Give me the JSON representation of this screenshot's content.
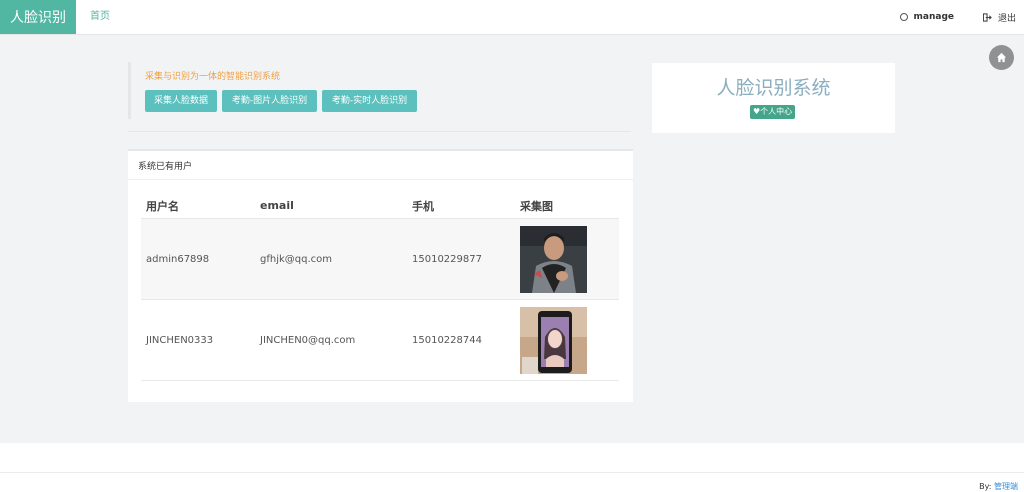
{
  "header": {
    "brand": "人脸识别",
    "nav_home": "首页",
    "user": "manage",
    "logout": "退出"
  },
  "actions": {
    "note": "采集与识别为一体的智能识别系统",
    "buttons": [
      "采集人脸数据",
      "考勤-图片人脸识别",
      "考勤-实时人脸识别"
    ]
  },
  "users_card": {
    "title": "系统已有用户",
    "columns": [
      "用户名",
      "email",
      "手机",
      "采集图"
    ],
    "rows": [
      {
        "username": "admin67898",
        "email": "gfhjk@qq.com",
        "phone": "15010229877"
      },
      {
        "username": "JINCHEN0333",
        "email": "JINCHEN0@qq.com",
        "phone": "15010228744"
      }
    ]
  },
  "system_card": {
    "title": "人脸识别系统",
    "badge": "个人中心"
  },
  "footer": {
    "by_label": "By:",
    "by_link": "管理端"
  },
  "colors": {
    "brand": "#51b7a2",
    "button": "#5bc0be",
    "badge": "#45a58a",
    "note": "#f0a040"
  },
  "icons": [
    "circle-icon",
    "logout-icon",
    "home-icon",
    "heart-icon"
  ]
}
